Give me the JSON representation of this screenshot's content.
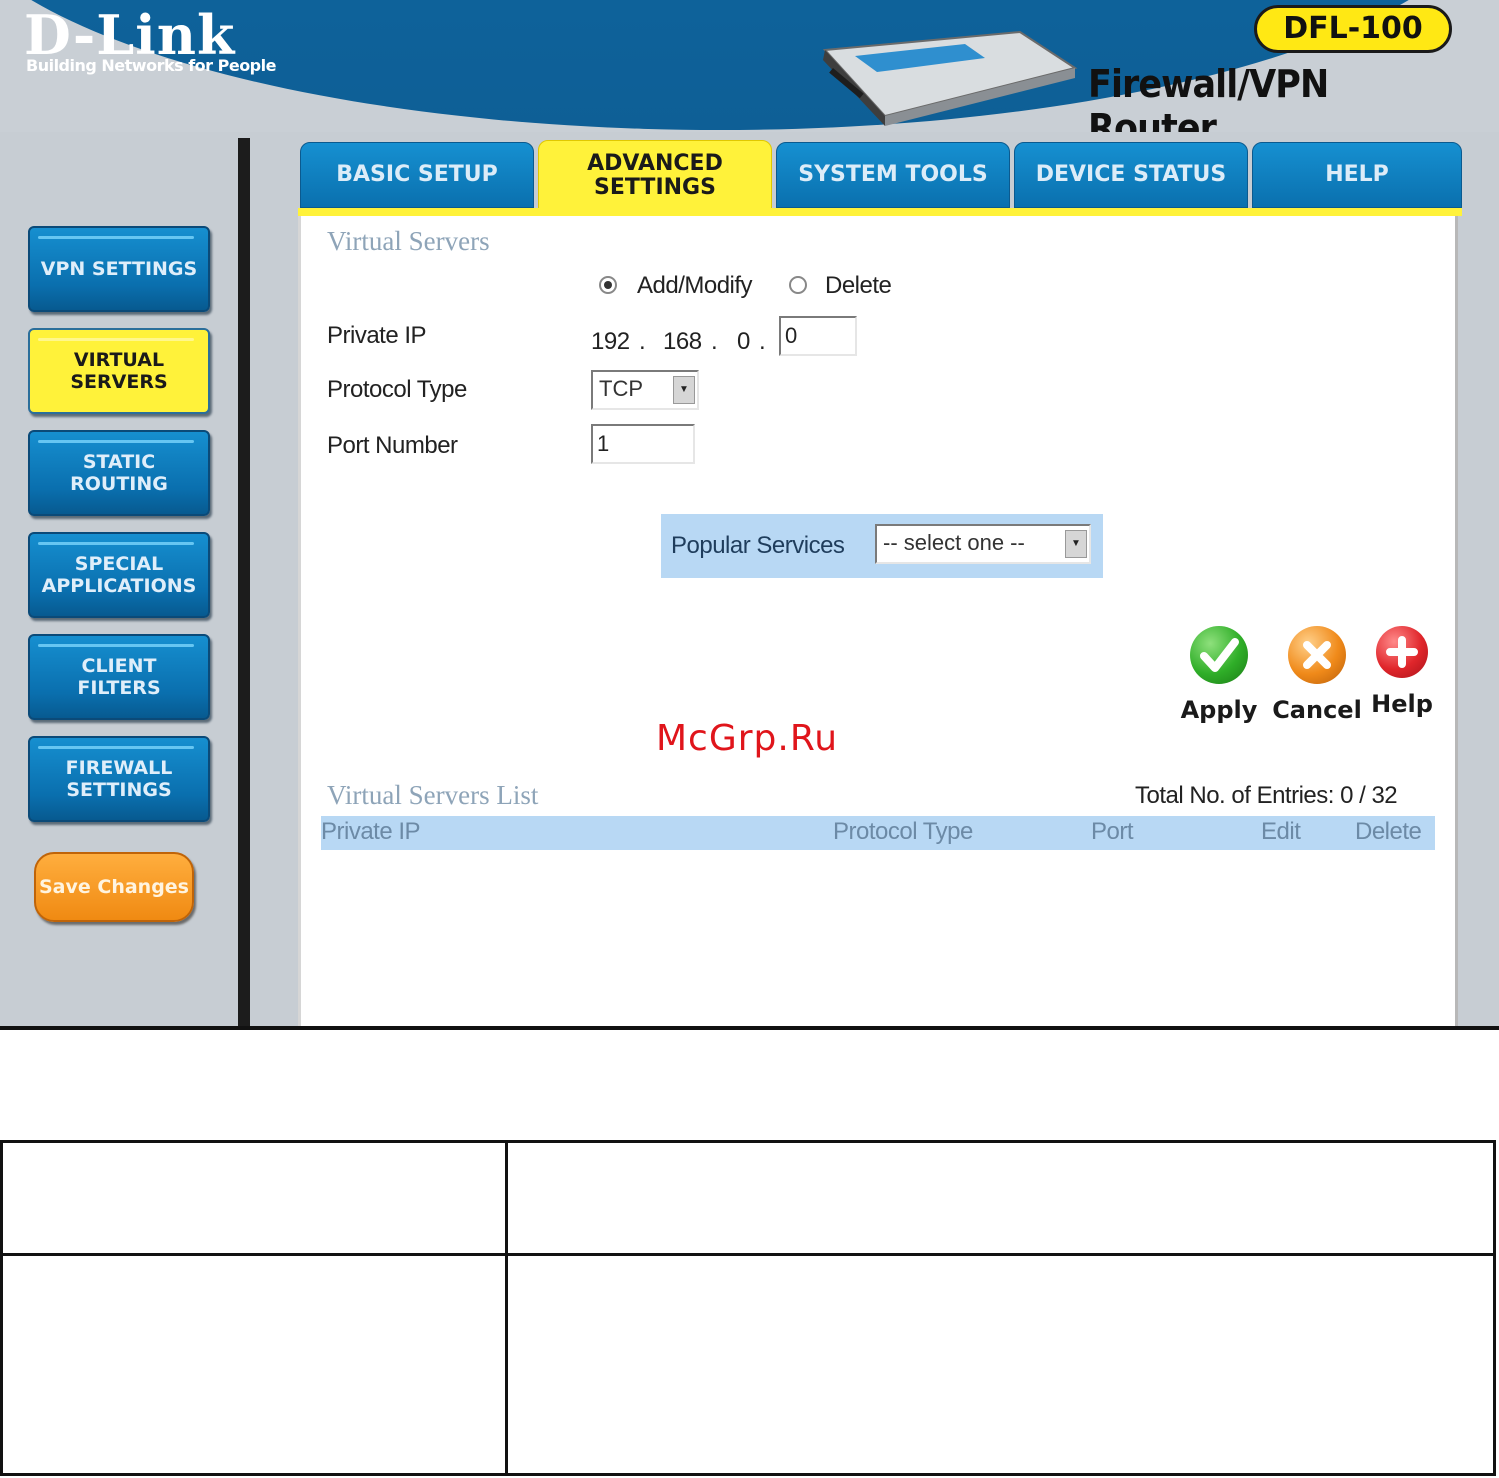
{
  "header": {
    "logo": "D-Link",
    "tagline": "Building Networks for People",
    "model": "DFL-100",
    "product": "Firewall/VPN Router"
  },
  "tabs": [
    {
      "label": "BASIC SETUP",
      "active": false
    },
    {
      "label": "ADVANCED SETTINGS",
      "active": true
    },
    {
      "label": "SYSTEM TOOLS",
      "active": false
    },
    {
      "label": "DEVICE STATUS",
      "active": false
    },
    {
      "label": "HELP",
      "active": false
    }
  ],
  "sidebar": {
    "items": [
      {
        "label": "VPN SETTINGS",
        "active": false
      },
      {
        "label": "VIRTUAL SERVERS",
        "active": true
      },
      {
        "label": "STATIC ROUTING",
        "active": false
      },
      {
        "label": "SPECIAL APPLICATIONS",
        "active": false
      },
      {
        "label": "CLIENT FILTERS",
        "active": false
      },
      {
        "label": "FIREWALL SETTINGS",
        "active": false
      }
    ],
    "save_label": "Save Changes"
  },
  "form": {
    "title": "Virtual Servers",
    "mode_options": [
      {
        "label": "Add/Modify",
        "checked": true
      },
      {
        "label": "Delete",
        "checked": false
      }
    ],
    "private_ip_label": "Private IP",
    "ip_octet_1": "192",
    "ip_octet_2": "168",
    "ip_octet_3": "0",
    "ip_sep": ".",
    "ip_last_value": "0",
    "protocol_label": "Protocol Type",
    "protocol_value": "TCP",
    "port_label": "Port Number",
    "port_value": "1",
    "popular_label": "Popular Services",
    "popular_value": "-- select one --"
  },
  "actions": [
    {
      "label": "Apply",
      "icon": "check-icon",
      "color": "#2fae28"
    },
    {
      "label": "Cancel",
      "icon": "x-icon",
      "color": "#f08a1a"
    },
    {
      "label": "Help",
      "icon": "plus-icon",
      "color": "#e0262b"
    }
  ],
  "list": {
    "title": "Virtual Servers List",
    "entries_text": "Total No. of Entries: 0 / 32",
    "columns": [
      "Private IP",
      "Protocol Type",
      "Port",
      "Edit",
      "Delete"
    ]
  },
  "watermark": "McGrp.Ru",
  "colors": {
    "brand_blue": "#0f6aa6",
    "active_yellow": "#fff23a",
    "save_orange": "#f59a1e",
    "panel_blue": "#b8d8f4"
  }
}
